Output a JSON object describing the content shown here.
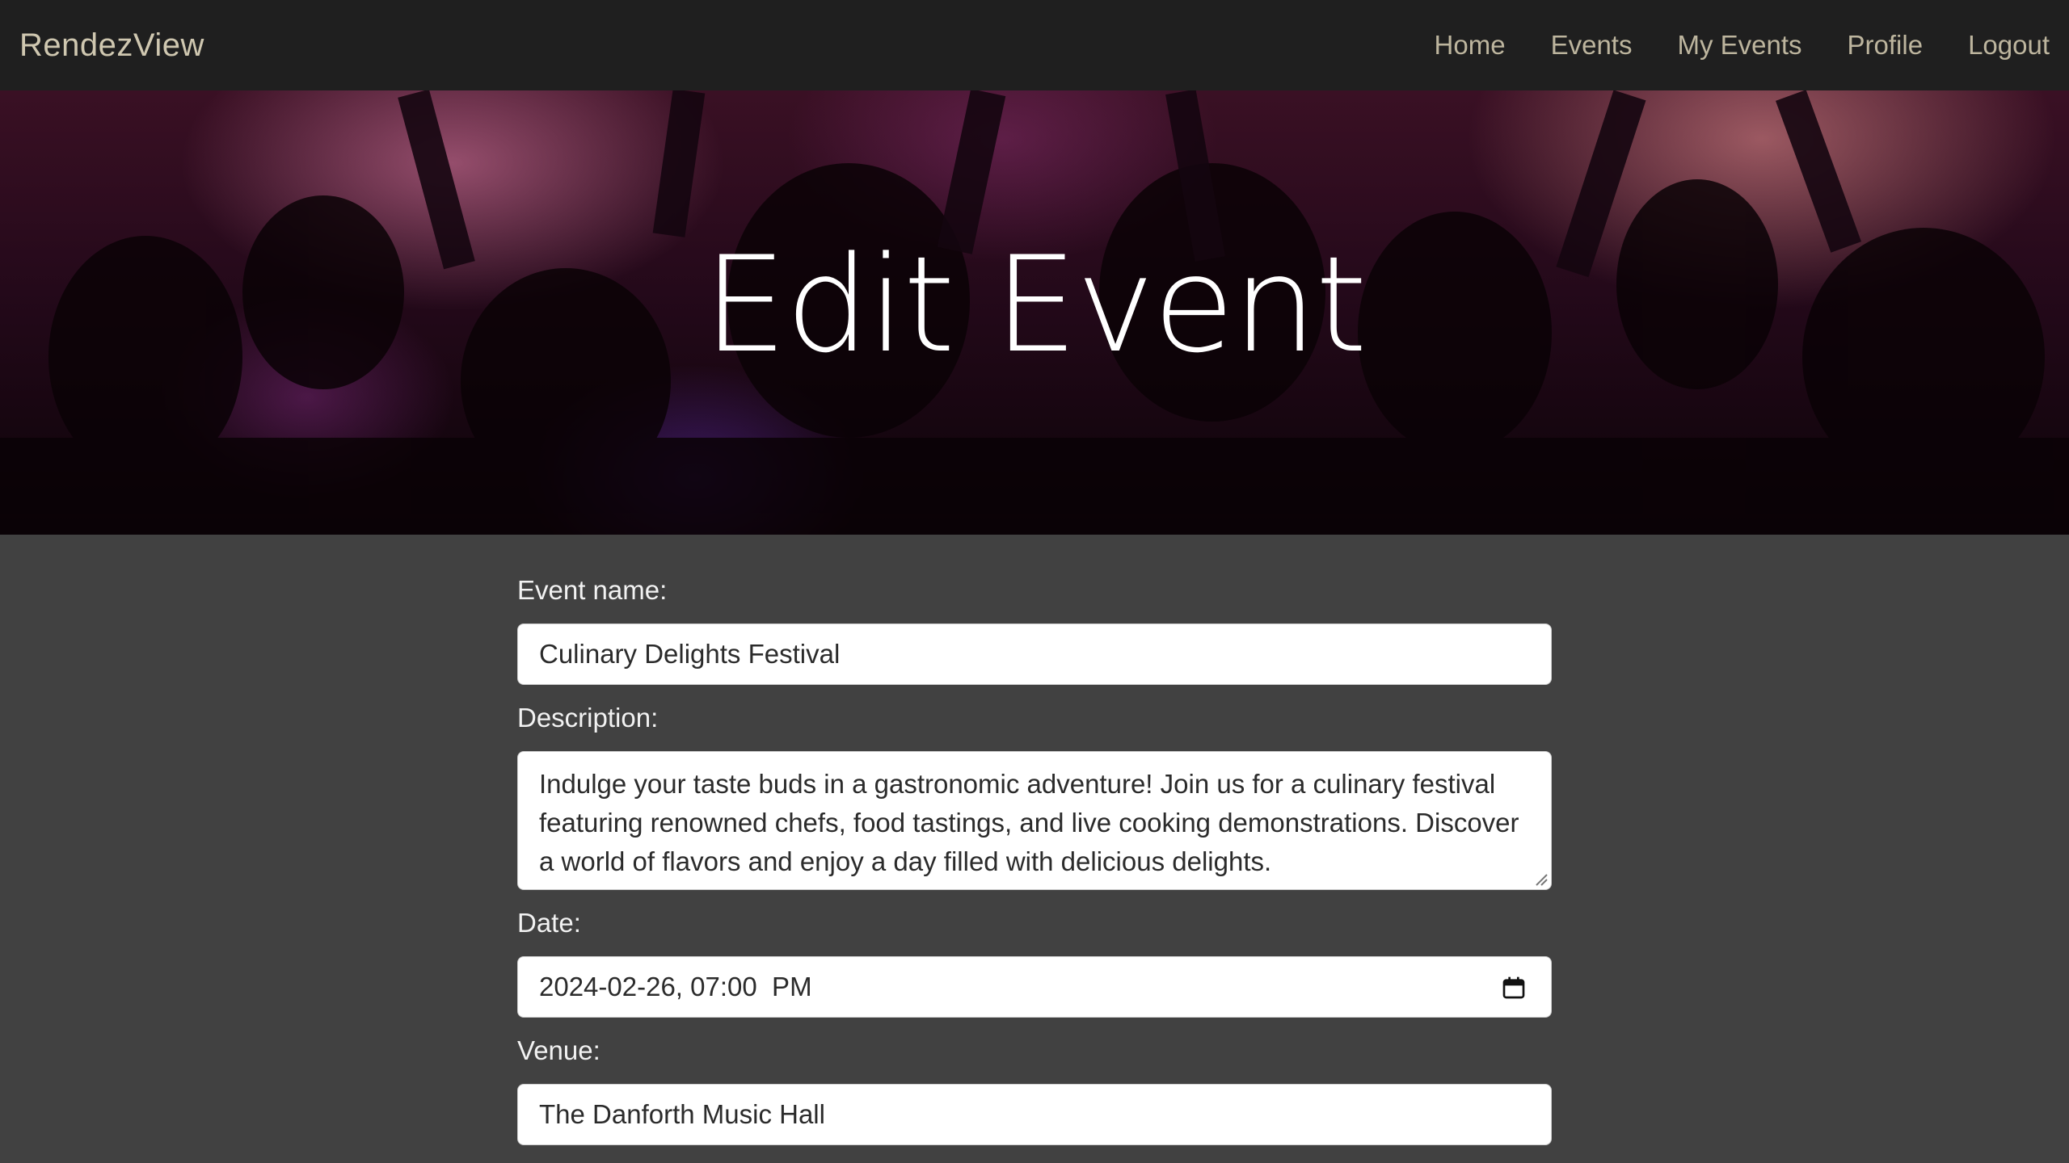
{
  "nav": {
    "brand": "RendezView",
    "links": [
      "Home",
      "Events",
      "My Events",
      "Profile",
      "Logout"
    ]
  },
  "hero": {
    "title": "Edit Event"
  },
  "form": {
    "event_name": {
      "label": "Event name:",
      "value": "Culinary Delights Festival"
    },
    "description": {
      "label": "Description:",
      "value": "Indulge your taste buds in a gastronomic adventure! Join us for a culinary festival featuring renowned chefs, food tastings, and live cooking demonstrations. Discover a world of flavors and enjoy a day filled with delicious delights."
    },
    "date": {
      "label": "Date:",
      "value": "2024-02-26, 07:00  PM"
    },
    "venue": {
      "label": "Venue:",
      "value": "The Danforth Music Hall"
    }
  },
  "colors": {
    "navbar_bg": "#1f1f1f",
    "page_bg": "#414141",
    "nav_text": "#bdb59e"
  }
}
